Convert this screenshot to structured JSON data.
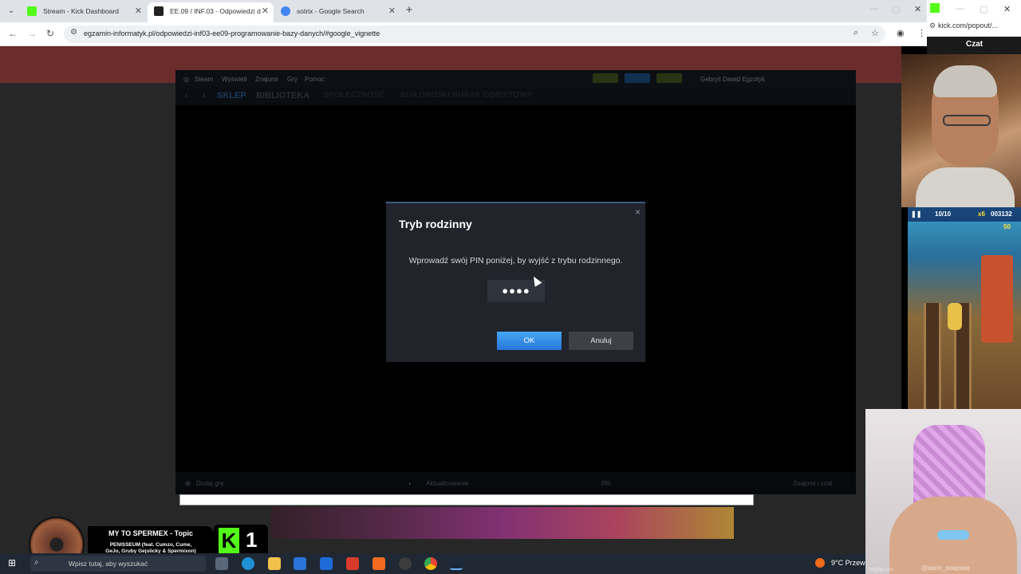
{
  "browser": {
    "tabs": [
      {
        "title": "Stream - Kick Dashboard",
        "favicon_color": "#53fc18"
      },
      {
        "title": "EE.09 / INF.03 - Odpowiedzi d",
        "favicon_color": "#222222"
      },
      {
        "title": "sotrix - Google Search",
        "favicon_color": "#4285f4"
      }
    ],
    "new_tab": "+",
    "url": "egzamin-informatyk.pl/odpowiedzi-inf03-ee09-programowanie-bazy-danych/#google_vignette"
  },
  "popout": {
    "url": "kick.com/popout/...",
    "title": "Czat"
  },
  "steam": {
    "menu": [
      "Steam",
      "Wyświetl",
      "Znajomi",
      "Gry",
      "Pomoc"
    ],
    "nav": [
      "SKLEP",
      "BIBLIOTEKA",
      "SPOŁECZNOŚĆ",
      "BIAŁORUSKI BURAK OBIEKTOWY"
    ],
    "user": "Gebryś Dawid Egzotyk",
    "status_left": "Dodaj grę",
    "status_mid": "Aktualizowanie",
    "status_right": "Znajomi i czat",
    "status_pct": "0%"
  },
  "dialog": {
    "title": "Tryb rodzinny",
    "message": "Wprowadź swój PIN poniżej, by wyjść z trybu rodzinnego.",
    "pin": "●●●●",
    "ok": "OK",
    "cancel": "Anuluj",
    "close": "×"
  },
  "game_hud": {
    "moves": "10/10",
    "multiplier": "x6",
    "score": "003132",
    "coins": "50"
  },
  "music": {
    "title": "MY TO SPERMEX - Topic",
    "artist_line1": "PENISSEUM (feat. Cumzo, Cume,",
    "artist_line2": "GeJo, Gruby Gejslicky & Spermixon)"
  },
  "kick_badge": {
    "letter": "K",
    "count": "1"
  },
  "handcam": {
    "handle": "@asmr_soapsea",
    "watermark": "imgflip.com"
  },
  "taskbar": {
    "search_placeholder": "Wpisz tutaj, aby wyszukać",
    "weather": "9°C  Przew"
  }
}
